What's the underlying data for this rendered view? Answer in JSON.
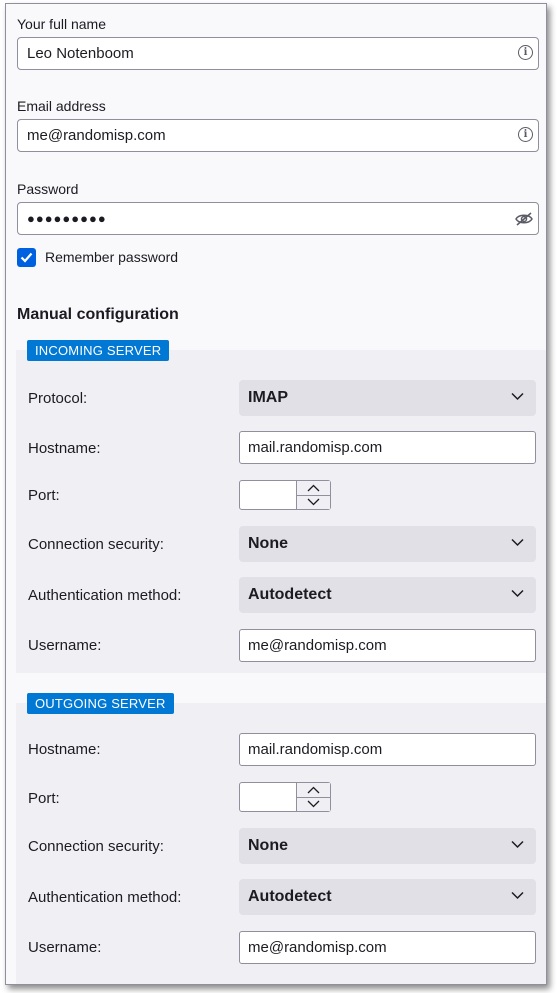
{
  "account": {
    "name_label": "Your full name",
    "name_value": "Leo Notenboom",
    "email_label": "Email address",
    "email_value": "me@randomisp.com",
    "password_label": "Password",
    "password_value": "●●●●●●●●●",
    "remember_label": "Remember password",
    "remember_checked": true
  },
  "manual": {
    "title": "Manual configuration",
    "incoming": {
      "badge": "INCOMING SERVER",
      "protocol_label": "Protocol:",
      "protocol_value": "IMAP",
      "hostname_label": "Hostname:",
      "hostname_value": "mail.randomisp.com",
      "port_label": "Port:",
      "port_value": "",
      "security_label": "Connection security:",
      "security_value": "None",
      "auth_label": "Authentication method:",
      "auth_value": "Autodetect",
      "username_label": "Username:",
      "username_value": "me@randomisp.com"
    },
    "outgoing": {
      "badge": "OUTGOING SERVER",
      "hostname_label": "Hostname:",
      "hostname_value": "mail.randomisp.com",
      "port_label": "Port:",
      "port_value": "",
      "security_label": "Connection security:",
      "security_value": "None",
      "auth_label": "Authentication method:",
      "auth_value": "Autodetect",
      "username_label": "Username:",
      "username_value": "me@randomisp.com"
    }
  },
  "colors": {
    "accent": "#0061e0",
    "badge": "#0078d4",
    "panel": "#f0f0f4",
    "select_bg": "#e0e0e6"
  }
}
